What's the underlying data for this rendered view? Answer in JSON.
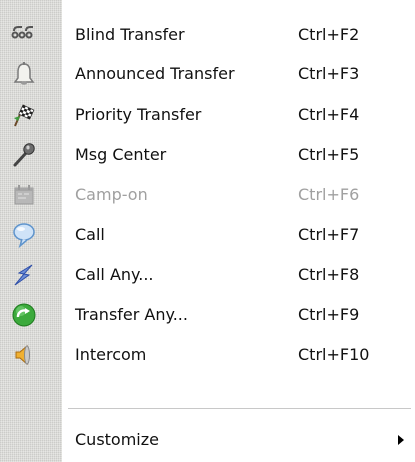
{
  "menu": {
    "items": [
      {
        "label": "Blind Transfer",
        "shortcut": "Ctrl+F2",
        "icon": "blind-transfer-icon",
        "enabled": true
      },
      {
        "label": "Announced Transfer",
        "shortcut": "Ctrl+F3",
        "icon": "bell-icon",
        "enabled": true
      },
      {
        "label": "Priority Transfer",
        "shortcut": "Ctrl+F4",
        "icon": "checkered-flag-icon",
        "enabled": true
      },
      {
        "label": "Msg Center",
        "shortcut": "Ctrl+F5",
        "icon": "microphone-icon",
        "enabled": true
      },
      {
        "label": "Camp-on",
        "shortcut": "Ctrl+F6",
        "icon": "camp-on-icon",
        "enabled": false
      },
      {
        "label": "Call",
        "shortcut": "Ctrl+F7",
        "icon": "speech-bubble-icon",
        "enabled": true
      },
      {
        "label": "Call Any...",
        "shortcut": "Ctrl+F8",
        "icon": "lightning-icon",
        "enabled": true
      },
      {
        "label": "Transfer Any...",
        "shortcut": "Ctrl+F9",
        "icon": "green-arrow-icon",
        "enabled": true
      },
      {
        "label": "Intercom",
        "shortcut": "Ctrl+F10",
        "icon": "speaker-icon",
        "enabled": true
      }
    ],
    "customize": {
      "label": "Customize",
      "icon": "chevron-right-icon"
    }
  },
  "colors": {
    "gutter": "#dcdcd8",
    "text": "#111111",
    "disabled_text": "#a0a0a0",
    "separator": "#c8c8c8"
  }
}
